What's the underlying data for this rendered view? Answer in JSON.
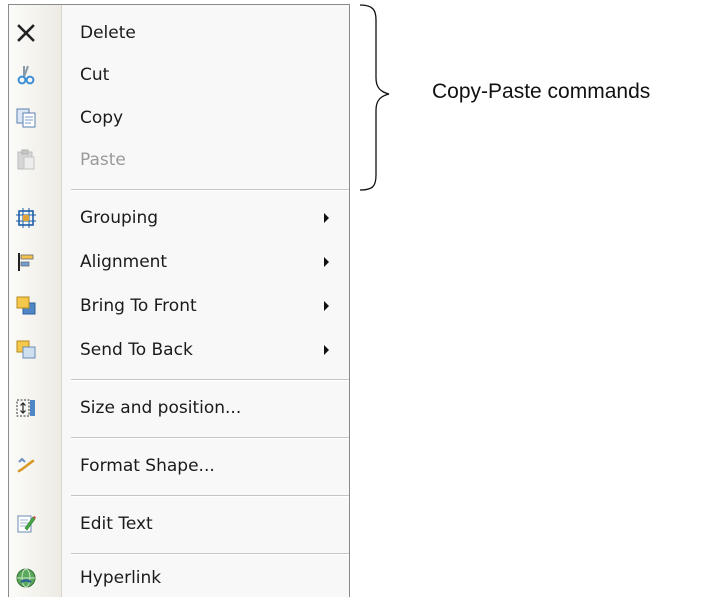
{
  "menu": {
    "items": [
      {
        "label": "Delete",
        "icon": "delete-icon",
        "submenu": false,
        "disabled": false
      },
      {
        "label": "Cut",
        "icon": "cut-icon",
        "submenu": false,
        "disabled": false
      },
      {
        "label": "Copy",
        "icon": "copy-icon",
        "submenu": false,
        "disabled": false
      },
      {
        "label": "Paste",
        "icon": "paste-icon",
        "submenu": false,
        "disabled": true
      },
      {
        "label": "Grouping",
        "icon": "grouping-icon",
        "submenu": true,
        "disabled": false
      },
      {
        "label": "Alignment",
        "icon": "alignment-icon",
        "submenu": true,
        "disabled": false
      },
      {
        "label": "Bring To Front",
        "icon": "bring-to-front-icon",
        "submenu": true,
        "disabled": false
      },
      {
        "label": "Send To Back",
        "icon": "send-to-back-icon",
        "submenu": true,
        "disabled": false
      },
      {
        "label": "Size and position...",
        "icon": "size-position-icon",
        "submenu": false,
        "disabled": false
      },
      {
        "label": "Format Shape...",
        "icon": "format-shape-icon",
        "submenu": false,
        "disabled": false
      },
      {
        "label": "Edit Text",
        "icon": "edit-text-icon",
        "submenu": false,
        "disabled": false
      },
      {
        "label": "Hyperlink",
        "icon": "hyperlink-icon",
        "submenu": false,
        "disabled": false
      }
    ]
  },
  "annotation": {
    "text": "Copy-Paste commands"
  }
}
